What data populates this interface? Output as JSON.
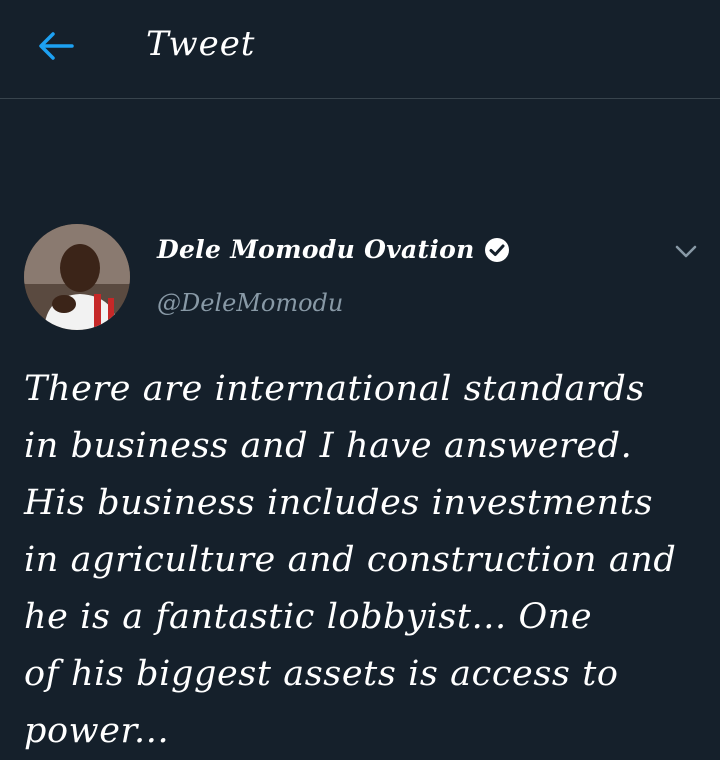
{
  "header": {
    "back_icon": "arrow-left-icon",
    "title": "Tweet"
  },
  "tweet": {
    "author": {
      "display_name": "Dele Momodu Ovation",
      "verified_icon": "verified-badge-icon",
      "handle": "@DeleMomodu"
    },
    "menu_icon": "chevron-down-icon",
    "text_lines": [
      "There are international standards",
      "in business and I have answered.",
      "His business includes investments",
      "in agriculture and construction and",
      "he is a fantastic lobbyist... One",
      "of his biggest assets is access to",
      "power..."
    ]
  },
  "colors": {
    "background": "#15202b",
    "accent": "#1da1f2",
    "secondary_text": "#8899a6",
    "divider": "#38444d"
  }
}
